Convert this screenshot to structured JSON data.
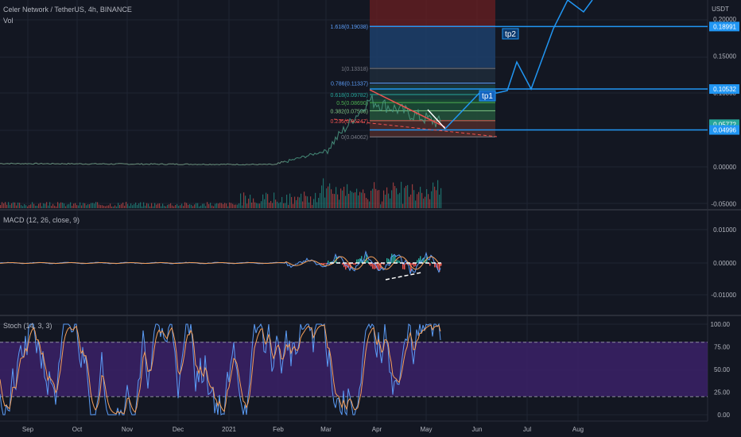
{
  "header": {
    "title": "Celer Network / TetherUS, 4h, BINANCE",
    "vol_label": "Vol",
    "currency": "USDT"
  },
  "colors": {
    "background": "#131722",
    "grid": "#1f2433",
    "up": "#26a69a",
    "down": "#ef5350",
    "blue_line": "#2196f3",
    "fib_high_zone": "#6b1f22",
    "fib_target_zone": "#1d3f6b",
    "stoch_band": "#3b2167",
    "macd_line": "#5b9cf6",
    "signal_line": "#f5a05a",
    "stoch_k": "#5b9cf6",
    "stoch_d": "#f5a05a",
    "price_label_current": "#26a69a"
  },
  "x_axis": {
    "labels": [
      "Sep",
      "Oct",
      "Nov",
      "Dec",
      "2021",
      "Feb",
      "Mar",
      "Apr",
      "May",
      "Jun",
      "Jul",
      "Aug"
    ]
  },
  "price_axis": {
    "ticks": [
      "0.20000",
      "0.15000",
      "0.10000",
      "0.05000",
      "0.00000",
      "-0.05000"
    ],
    "labels": [
      {
        "text": "0.18991",
        "color": "#2196f3",
        "value": 0.18991
      },
      {
        "text": "0.10532",
        "color": "#2196f3",
        "value": 0.10532
      },
      {
        "text": "0.05772",
        "color": "#26a69a",
        "value": 0.05772
      },
      {
        "text": "0.04996",
        "color": "#2196f3",
        "value": 0.04996
      }
    ]
  },
  "fib_levels": [
    {
      "label": "1.618(0.19038)",
      "value": 0.19038,
      "color": "#5b9cf6"
    },
    {
      "label": "1(0.13318)",
      "value": 0.13318,
      "color": "#787b86"
    },
    {
      "label": "0.786(0.11337)",
      "value": 0.11337,
      "color": "#5b9cf6"
    },
    {
      "label": "0.618(0.09782)",
      "value": 0.09782,
      "color": "#26a69a"
    },
    {
      "label": "0.5(0.08690)",
      "value": 0.0869,
      "color": "#4caf50"
    },
    {
      "label": "0.382(0.07598)",
      "value": 0.07598,
      "color": "#81c784"
    },
    {
      "label": "0.236(0.06247)",
      "value": 0.06247,
      "color": "#ef5350"
    },
    {
      "label": "0(0.04062)",
      "value": 0.04062,
      "color": "#787b86"
    }
  ],
  "targets": {
    "tp1": "tp1",
    "tp2": "tp2"
  },
  "macd": {
    "label": "MACD (12, 26, close, 9)",
    "ticks": [
      "0.01000",
      "0.00000",
      "-0.01000"
    ]
  },
  "stoch": {
    "label": "Stoch (14, 3, 3)",
    "ticks": [
      "100.00",
      "75.00",
      "50.00",
      "25.00",
      "0.00"
    ],
    "band": [
      20,
      80
    ]
  },
  "chart_data": {
    "type": "line",
    "series": [
      {
        "x": [
          "Sep",
          "Oct",
          "Nov",
          "Dec",
          "2021",
          "Feb",
          "Mar",
          "Apr",
          "May"
        ],
        "values": [
          0.0045,
          0.004,
          0.003,
          0.0025,
          0.0035,
          0.006,
          0.022,
          0.072,
          0.058
        ]
      },
      {
        "x": [
          "May",
          "Jun",
          "Jul",
          "Aug"
        ],
        "values": [
          0.058,
          0.10532,
          0.18991,
          0.2
        ]
      }
    ],
    "ylim": [
      -0.055,
      0.205
    ],
    "levels": [
      0.18991,
      0.10532,
      0.05772,
      0.04996
    ]
  }
}
